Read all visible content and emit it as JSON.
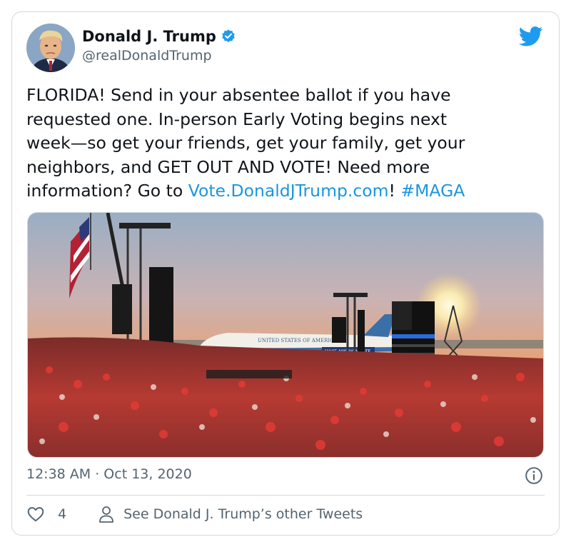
{
  "user": {
    "display_name": "Donald J. Trump",
    "handle": "@realDonaldTrump",
    "verified": true
  },
  "tweet": {
    "text_lines": [
      "FLORIDA! Send in your absentee ballot if you have",
      "requested one. In-person Early Voting begins next",
      "week—so get your friends, get your family, get your",
      "neighbors, and GET OUT AND VOTE! Need more"
    ],
    "last_line_prefix": "information? Go to ",
    "link_text": "Vote.DonaldJTrump.com",
    "after_link": "! ",
    "hashtag": "#MAGA",
    "timestamp": "12:38 AM · Oct 13, 2020"
  },
  "actions": {
    "like_count": "4",
    "other_tweets_label": "See Donald J. Trump’s other Tweets"
  },
  "media": {
    "plane_text": "UNITED STATES OF AMERICA",
    "banner_text": "MAKE AMERICA VOTE"
  },
  "colors": {
    "link": "#1b95e0",
    "verified": "#1d9bf0",
    "secondary_text": "#536471",
    "border": "#cfd9de"
  },
  "icons": {
    "verified": "verified-badge-icon",
    "brand": "twitter-bird-icon",
    "info": "info-icon",
    "like": "heart-icon",
    "profile": "person-icon"
  }
}
